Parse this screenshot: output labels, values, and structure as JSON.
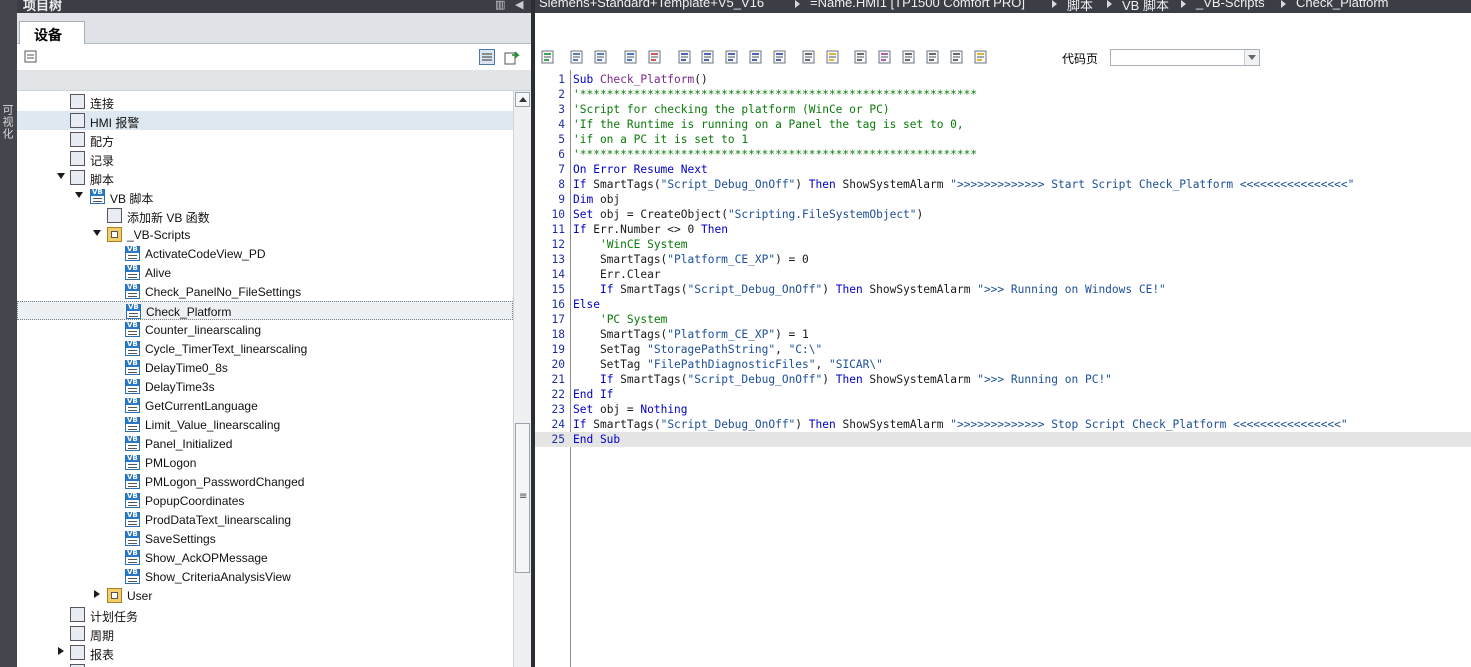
{
  "left_panel": {
    "side_tab_label": "可视化",
    "title": "项目树",
    "devices_tab": "设备",
    "tree": [
      {
        "label": "连接",
        "indent": 1,
        "icon": "connection-icon"
      },
      {
        "label": "HMI 报警",
        "indent": 1,
        "icon": "alarm-icon",
        "highlighted": true
      },
      {
        "label": "配方",
        "indent": 1,
        "icon": "recipe-icon"
      },
      {
        "label": "记录",
        "indent": 1,
        "icon": "log-icon"
      },
      {
        "label": "脚本",
        "indent": 1,
        "icon": "scripts-icon",
        "expanded": true
      },
      {
        "label": "VB 脚本",
        "indent": 2,
        "icon": "vb-scripts-folder-icon",
        "expanded": true
      },
      {
        "label": "添加新 VB 函数",
        "indent": 3,
        "icon": "add-function-icon"
      },
      {
        "label": "_VB-Scripts",
        "indent": 3,
        "icon": "folder-icon",
        "expanded": true
      },
      {
        "label": "ActivateCodeView_PD",
        "indent": 4,
        "icon": "vb-script-icon"
      },
      {
        "label": "Alive",
        "indent": 4,
        "icon": "vb-script-icon"
      },
      {
        "label": "Check_PanelNo_FileSettings",
        "indent": 4,
        "icon": "vb-script-icon"
      },
      {
        "label": "Check_Platform",
        "indent": 4,
        "icon": "vb-script-icon",
        "selected": true
      },
      {
        "label": "Counter_linearscaling",
        "indent": 4,
        "icon": "vb-script-icon"
      },
      {
        "label": "Cycle_TimerText_linearscaling",
        "indent": 4,
        "icon": "vb-script-icon"
      },
      {
        "label": "DelayTime0_8s",
        "indent": 4,
        "icon": "vb-script-icon"
      },
      {
        "label": "DelayTime3s",
        "indent": 4,
        "icon": "vb-script-icon"
      },
      {
        "label": "GetCurrentLanguage",
        "indent": 4,
        "icon": "vb-script-icon"
      },
      {
        "label": "Limit_Value_linearscaling",
        "indent": 4,
        "icon": "vb-script-icon"
      },
      {
        "label": "Panel_Initialized",
        "indent": 4,
        "icon": "vb-script-icon"
      },
      {
        "label": "PMLogon",
        "indent": 4,
        "icon": "vb-script-icon"
      },
      {
        "label": "PMLogon_PasswordChanged",
        "indent": 4,
        "icon": "vb-script-icon"
      },
      {
        "label": "PopupCoordinates",
        "indent": 4,
        "icon": "vb-script-icon"
      },
      {
        "label": "ProdDataText_linearscaling",
        "indent": 4,
        "icon": "vb-script-icon"
      },
      {
        "label": "SaveSettings",
        "indent": 4,
        "icon": "vb-script-icon"
      },
      {
        "label": "Show_AckOPMessage",
        "indent": 4,
        "icon": "vb-script-icon"
      },
      {
        "label": "Show_CriteriaAnalysisView",
        "indent": 4,
        "icon": "vb-script-icon"
      },
      {
        "label": "User",
        "indent": 3,
        "icon": "folder-icon",
        "collapsed": true
      },
      {
        "label": "计划任务",
        "indent": 1,
        "icon": "scheduler-icon"
      },
      {
        "label": "周期",
        "indent": 1,
        "icon": "cycle-icon"
      },
      {
        "label": "报表",
        "indent": 1,
        "icon": "report-icon",
        "collapsed": true
      },
      {
        "label": "",
        "indent": 1,
        "icon": "misc-icon"
      }
    ]
  },
  "breadcrumb": [
    "Siemens+Standard+Template+V5_V16",
    "=Name.HMI1 [TP1500 Comfort PRO]",
    "脚本",
    "VB 脚本",
    "_VB-Scripts",
    "Check_Platform"
  ],
  "editor": {
    "codepage_label": "代码页",
    "codepage_value": "",
    "current_line": 25,
    "lines": [
      [
        [
          "kw",
          "Sub "
        ],
        [
          "fn",
          "Check_Platform"
        ],
        [
          "nm",
          "()"
        ]
      ],
      [
        [
          "cm",
          "'***********************************************************"
        ]
      ],
      [
        [
          "cm",
          "'Script for checking the platform (WinCe or PC)"
        ]
      ],
      [
        [
          "cm",
          "'If the Runtime is running on a Panel the tag is set to 0,"
        ]
      ],
      [
        [
          "cm",
          "'if on a PC it is set to 1"
        ]
      ],
      [
        [
          "cm",
          "'***********************************************************"
        ]
      ],
      [
        [
          "kw",
          "On Error Resume Next"
        ]
      ],
      [
        [
          "kw",
          "If "
        ],
        [
          "nm",
          "SmartTags("
        ],
        [
          "st",
          "\"Script_Debug_OnOff\""
        ],
        [
          "nm",
          ") "
        ],
        [
          "kw",
          "Then "
        ],
        [
          "nm",
          "ShowSystemAlarm "
        ],
        [
          "st",
          "\">>>>>>>>>>>>> Start Script Check_Platform <<<<<<<<<<<<<<<<\""
        ]
      ],
      [
        [
          "kw",
          "Dim "
        ],
        [
          "nm",
          "obj"
        ]
      ],
      [
        [
          "kw",
          "Set "
        ],
        [
          "nm",
          "obj = CreateObject("
        ],
        [
          "st",
          "\"Scripting.FileSystemObject\""
        ],
        [
          "nm",
          ")"
        ]
      ],
      [
        [
          "kw",
          "If "
        ],
        [
          "nm",
          "Err.Number <> 0 "
        ],
        [
          "kw",
          "Then"
        ]
      ],
      [
        [
          "nm",
          "    "
        ],
        [
          "cm",
          "'WinCE System"
        ]
      ],
      [
        [
          "nm",
          "    SmartTags("
        ],
        [
          "st",
          "\"Platform_CE_XP\""
        ],
        [
          "nm",
          ") = 0"
        ]
      ],
      [
        [
          "nm",
          "    Err.Clear"
        ]
      ],
      [
        [
          "nm",
          "    "
        ],
        [
          "kw",
          "If "
        ],
        [
          "nm",
          "SmartTags("
        ],
        [
          "st",
          "\"Script_Debug_OnOff\""
        ],
        [
          "nm",
          ") "
        ],
        [
          "kw",
          "Then "
        ],
        [
          "nm",
          "ShowSystemAlarm "
        ],
        [
          "st",
          "\">>> Running on Windows CE!\""
        ]
      ],
      [
        [
          "kw",
          "Else"
        ]
      ],
      [
        [
          "nm",
          "    "
        ],
        [
          "cm",
          "'PC System"
        ]
      ],
      [
        [
          "nm",
          "    SmartTags("
        ],
        [
          "st",
          "\"Platform_CE_XP\""
        ],
        [
          "nm",
          ") = 1"
        ]
      ],
      [
        [
          "nm",
          "    SetTag "
        ],
        [
          "st",
          "\"StoragePathString\""
        ],
        [
          "nm",
          ", "
        ],
        [
          "st",
          "\"C:\\\""
        ]
      ],
      [
        [
          "nm",
          "    SetTag "
        ],
        [
          "st",
          "\"FilePathDiagnosticFiles\""
        ],
        [
          "nm",
          ", "
        ],
        [
          "st",
          "\"SICAR\\\""
        ]
      ],
      [
        [
          "nm",
          "    "
        ],
        [
          "kw",
          "If "
        ],
        [
          "nm",
          "SmartTags("
        ],
        [
          "st",
          "\"Script_Debug_OnOff\""
        ],
        [
          "nm",
          ") "
        ],
        [
          "kw",
          "Then "
        ],
        [
          "nm",
          "ShowSystemAlarm "
        ],
        [
          "st",
          "\">>> Running on PC!\""
        ]
      ],
      [
        [
          "kw",
          "End If"
        ]
      ],
      [
        [
          "kw",
          "Set "
        ],
        [
          "nm",
          "obj = "
        ],
        [
          "kw",
          "Nothing"
        ]
      ],
      [
        [
          "kw",
          "If "
        ],
        [
          "nm",
          "SmartTags("
        ],
        [
          "st",
          "\"Script_Debug_OnOff\""
        ],
        [
          "nm",
          ") "
        ],
        [
          "kw",
          "Then "
        ],
        [
          "nm",
          "ShowSystemAlarm "
        ],
        [
          "st",
          "\">>>>>>>>>>>>> Stop Script Check_Platform <<<<<<<<<<<<<<<<\""
        ]
      ],
      [
        [
          "kw",
          "End Sub"
        ]
      ]
    ]
  }
}
